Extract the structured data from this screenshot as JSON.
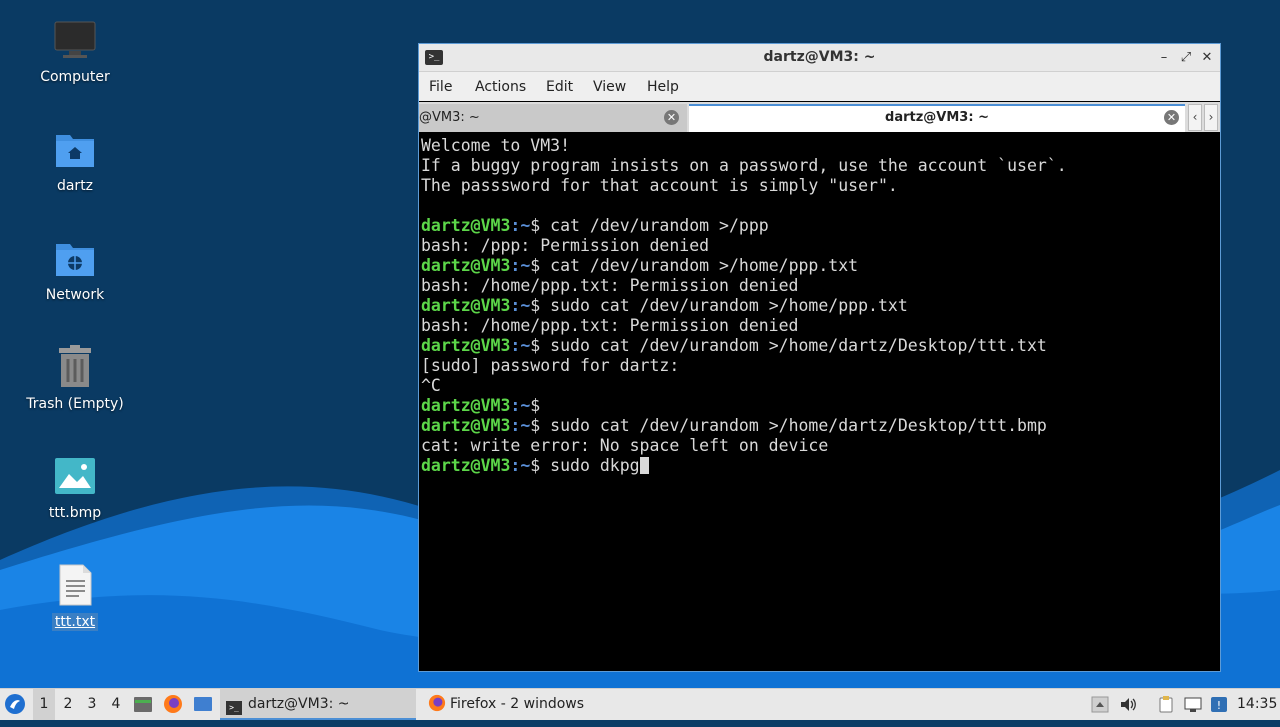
{
  "desktop": {
    "icons": [
      {
        "label": "Computer",
        "icon": "monitor-icon"
      },
      {
        "label": "dartz",
        "icon": "home-folder-icon"
      },
      {
        "label": "Network",
        "icon": "network-folder-icon"
      },
      {
        "label": "Trash (Empty)",
        "icon": "trash-icon"
      },
      {
        "label": "ttt.bmp",
        "icon": "image-file-icon"
      },
      {
        "label": "ttt.txt",
        "icon": "text-file-icon",
        "selected": true
      }
    ]
  },
  "window": {
    "title": "dartz@VM3: ~",
    "controls": {
      "minimize": "–",
      "maximize": "⤢",
      "close": "✕"
    },
    "menu": [
      "File",
      "Actions",
      "Edit",
      "View",
      "Help"
    ],
    "tabs": [
      {
        "label": "@VM3: ~",
        "active": false
      },
      {
        "label": "dartz@VM3: ~",
        "active": true
      }
    ]
  },
  "terminal": {
    "prompt_user": "dartz@VM3",
    "prompt_path": ":~",
    "prompt_symbol": "$ ",
    "lines": [
      {
        "type": "out",
        "text": "Welcome to VM3!"
      },
      {
        "type": "out",
        "text": "If a buggy program insists on a password, use the account `user`."
      },
      {
        "type": "out",
        "text": "The passsword for that account is simply \"user\"."
      },
      {
        "type": "out",
        "text": ""
      },
      {
        "type": "cmd",
        "text": "cat /dev/urandom >/ppp"
      },
      {
        "type": "out",
        "text": "bash: /ppp: Permission denied"
      },
      {
        "type": "cmd",
        "text": "cat /dev/urandom >/home/ppp.txt"
      },
      {
        "type": "out",
        "text": "bash: /home/ppp.txt: Permission denied"
      },
      {
        "type": "cmd",
        "text": "sudo cat /dev/urandom >/home/ppp.txt"
      },
      {
        "type": "out",
        "text": "bash: /home/ppp.txt: Permission denied"
      },
      {
        "type": "cmd",
        "text": "sudo cat /dev/urandom >/home/dartz/Desktop/ttt.txt"
      },
      {
        "type": "out",
        "text": "[sudo] password for dartz:"
      },
      {
        "type": "out",
        "text": "^C"
      },
      {
        "type": "cmd",
        "text": ""
      },
      {
        "type": "cmd",
        "text": "sudo cat /dev/urandom >/home/dartz/Desktop/ttt.bmp"
      },
      {
        "type": "out",
        "text": "cat: write error: No space left on device"
      },
      {
        "type": "cmd",
        "text": "sudo dkpg",
        "cursor": true
      }
    ]
  },
  "taskbar": {
    "workspaces": [
      "1",
      "2",
      "3",
      "4"
    ],
    "active_workspace": "1",
    "tasks": [
      {
        "label": "dartz@VM3: ~",
        "icon": "terminal-icon"
      },
      {
        "label": "Firefox - 2 windows",
        "icon": "firefox-icon"
      }
    ],
    "clock": "14:35"
  },
  "colors": {
    "prompt_user": "#5cd649",
    "prompt_path": "#5a8fd6",
    "terminal_bg": "#000000",
    "terminal_fg": "#d9d9d9",
    "accent": "#4c8fd5"
  }
}
